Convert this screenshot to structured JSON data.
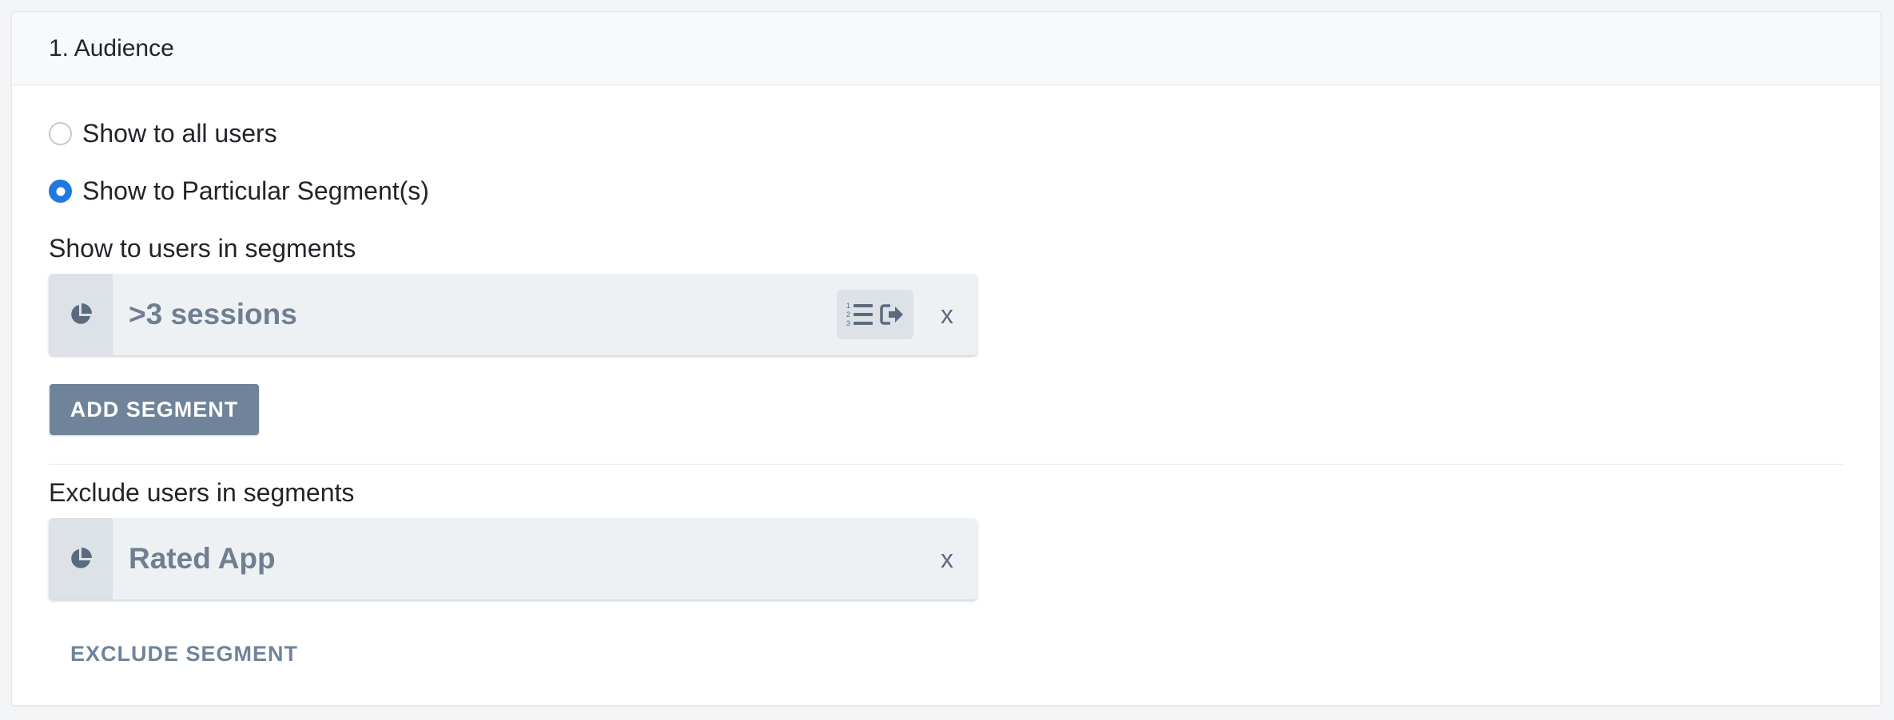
{
  "section": {
    "title": "1. Audience"
  },
  "audience_options": {
    "all_users_label": "Show to all users",
    "particular_label": "Show to Particular Segment(s)",
    "selected": "particular"
  },
  "include": {
    "label": "Show to users in segments",
    "segments": [
      {
        "name": ">3 sessions",
        "icon": "pie-chart-icon",
        "remove_label": "x"
      }
    ],
    "add_button_label": "ADD SEGMENT"
  },
  "exclude": {
    "label": "Exclude users in segments",
    "segments": [
      {
        "name": "Rated App",
        "icon": "pie-chart-icon",
        "remove_label": "x"
      }
    ],
    "exclude_button_label": "EXCLUDE SEGMENT"
  },
  "colors": {
    "accent_blue": "#1f7ae0",
    "button_slate": "#6f849b",
    "segment_text": "#6f7f91"
  }
}
